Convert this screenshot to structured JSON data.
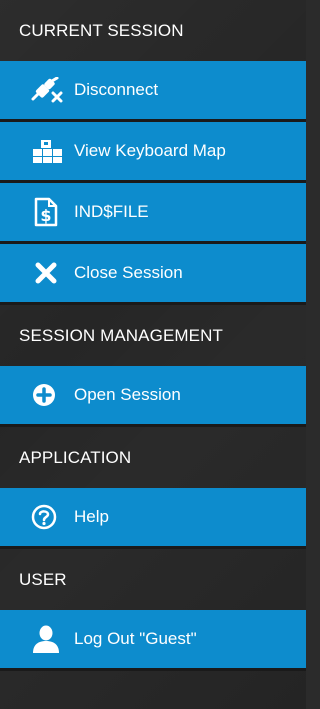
{
  "sections": {
    "current_session": {
      "header": "CURRENT SESSION",
      "items": {
        "disconnect": {
          "label": "Disconnect",
          "icon": "disconnect-icon"
        },
        "keyboard_map": {
          "label": "View Keyboard Map",
          "icon": "keyboard-map-icon"
        },
        "indfile": {
          "label": "IND$FILE",
          "icon": "file-transfer-icon"
        },
        "close_session": {
          "label": "Close Session",
          "icon": "close-icon"
        }
      }
    },
    "session_management": {
      "header": "SESSION MANAGEMENT",
      "items": {
        "open_session": {
          "label": "Open Session",
          "icon": "plus-circle-icon"
        }
      }
    },
    "application": {
      "header": "APPLICATION",
      "items": {
        "help": {
          "label": "Help",
          "icon": "help-icon"
        }
      }
    },
    "user": {
      "header": "USER",
      "items": {
        "logout": {
          "label": "Log Out \"Guest\"",
          "icon": "user-icon"
        }
      }
    }
  },
  "colors": {
    "item_background": "#0d8ccd",
    "header_background": "#262626",
    "text": "#ffffff"
  }
}
